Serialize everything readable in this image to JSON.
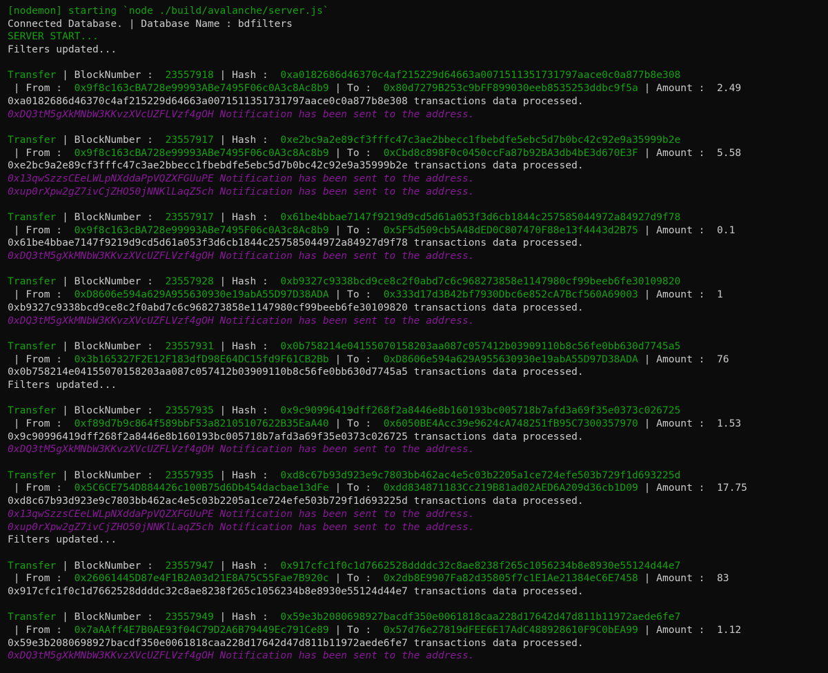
{
  "terminal": {
    "colors": {
      "background": "#0c0c0c",
      "default": "#cccccc",
      "green": "#13a10e",
      "purple": "#881798"
    },
    "lines": [
      {
        "kind": "text",
        "parts": [
          {
            "t": "[nodemon] starting `node ./build/avalanche/server.js`",
            "c": "g"
          }
        ]
      },
      {
        "kind": "text",
        "parts": [
          {
            "t": "Connected Database. | Database Name : bdfilters",
            "c": "w"
          }
        ]
      },
      {
        "kind": "text",
        "parts": [
          {
            "t": "SERVER START...",
            "c": "g"
          }
        ]
      },
      {
        "kind": "text",
        "parts": [
          {
            "t": "Filters updated...",
            "c": "w"
          }
        ]
      },
      {
        "kind": "blank",
        "parts": []
      },
      {
        "kind": "transfer",
        "parts": [
          {
            "t": "Transfer",
            "c": "g"
          },
          {
            "t": " | BlockNumber :  ",
            "c": "w"
          },
          {
            "t": "23557918",
            "c": "g"
          },
          {
            "t": " | Hash :  ",
            "c": "w"
          },
          {
            "t": "0xa0182686d46370c4af215229d64663a0071511351731797aace0c0a877b8e308",
            "c": "g"
          }
        ]
      },
      {
        "kind": "transfer-detail",
        "parts": [
          {
            "t": " | From :  ",
            "c": "w"
          },
          {
            "t": "0x9f8c163cBA728e99993ABe7495F06c0A3c8Ac8b9",
            "c": "g"
          },
          {
            "t": " | To :  ",
            "c": "w"
          },
          {
            "t": "0x80d7279B253c9bFF899030eeb8535253ddbc9f5a",
            "c": "g"
          },
          {
            "t": " | Amount :  2.49",
            "c": "w"
          }
        ]
      },
      {
        "kind": "processed",
        "parts": [
          {
            "t": "0xa0182686d46370c4af215229d64663a0071511351731797aace0c0a877b8e308 transactions data processed.",
            "c": "w"
          }
        ]
      },
      {
        "kind": "notification",
        "parts": [
          {
            "t": "0xDQ3tM5gXkMNbW3KKvzXVcUZFLVzf4gOH Notification has been sent to the address.",
            "c": "p"
          }
        ]
      },
      {
        "kind": "blank",
        "parts": []
      },
      {
        "kind": "transfer",
        "parts": [
          {
            "t": "Transfer",
            "c": "g"
          },
          {
            "t": " | BlockNumber :  ",
            "c": "w"
          },
          {
            "t": "23557917",
            "c": "g"
          },
          {
            "t": " | Hash :  ",
            "c": "w"
          },
          {
            "t": "0xe2bc9a2e89cf3fffc47c3ae2bbecc1fbebdfe5ebc5d7b0bc42c92e9a35999b2e",
            "c": "g"
          }
        ]
      },
      {
        "kind": "transfer-detail",
        "parts": [
          {
            "t": " | From :  ",
            "c": "w"
          },
          {
            "t": "0x9f8c163cBA728e99993ABe7495F06c0A3c8Ac8b9",
            "c": "g"
          },
          {
            "t": " | To :  ",
            "c": "w"
          },
          {
            "t": "0xCbd8c898F0c0450ccFa87b92BA3db4bE3d670E3F",
            "c": "g"
          },
          {
            "t": " | Amount :  5.58",
            "c": "w"
          }
        ]
      },
      {
        "kind": "processed",
        "parts": [
          {
            "t": "0xe2bc9a2e89cf3fffc47c3ae2bbecc1fbebdfe5ebc5d7b0bc42c92e9a35999b2e transactions data processed.",
            "c": "w"
          }
        ]
      },
      {
        "kind": "notification",
        "parts": [
          {
            "t": "0x13qwSzzsCEeLWLpNXddaPpVQZXFGUuPE Notification has been sent to the address.",
            "c": "p"
          }
        ]
      },
      {
        "kind": "notification",
        "parts": [
          {
            "t": "0xup0rXpw2gZ7ivCjZHO50jNNKlLaqZ5ch Notification has been sent to the address.",
            "c": "p"
          }
        ]
      },
      {
        "kind": "blank",
        "parts": []
      },
      {
        "kind": "transfer",
        "parts": [
          {
            "t": "Transfer",
            "c": "g"
          },
          {
            "t": " | BlockNumber :  ",
            "c": "w"
          },
          {
            "t": "23557917",
            "c": "g"
          },
          {
            "t": " | Hash :  ",
            "c": "w"
          },
          {
            "t": "0x61be4bbae7147f9219d9cd5d61a053f3d6cb1844c257585044972a84927d9f78",
            "c": "g"
          }
        ]
      },
      {
        "kind": "transfer-detail",
        "parts": [
          {
            "t": " | From :  ",
            "c": "w"
          },
          {
            "t": "0x9f8c163cBA728e99993ABe7495F06c0A3c8Ac8b9",
            "c": "g"
          },
          {
            "t": " | To :  ",
            "c": "w"
          },
          {
            "t": "0x5F5d509cb5A48dED0C807470F88e13f4443d2B75",
            "c": "g"
          },
          {
            "t": " | Amount :  0.1",
            "c": "w"
          }
        ]
      },
      {
        "kind": "processed",
        "parts": [
          {
            "t": "0x61be4bbae7147f9219d9cd5d61a053f3d6cb1844c257585044972a84927d9f78 transactions data processed.",
            "c": "w"
          }
        ]
      },
      {
        "kind": "notification",
        "parts": [
          {
            "t": "0xDQ3tM5gXkMNbW3KKvzXVcUZFLVzf4gOH Notification has been sent to the address.",
            "c": "p"
          }
        ]
      },
      {
        "kind": "blank",
        "parts": []
      },
      {
        "kind": "transfer",
        "parts": [
          {
            "t": "Transfer",
            "c": "g"
          },
          {
            "t": " | BlockNumber :  ",
            "c": "w"
          },
          {
            "t": "23557928",
            "c": "g"
          },
          {
            "t": " | Hash :  ",
            "c": "w"
          },
          {
            "t": "0xb9327c9338bcd9ce8c2f0abd7c6c968273858e1147980cf99beeb6fe30109820",
            "c": "g"
          }
        ]
      },
      {
        "kind": "transfer-detail",
        "parts": [
          {
            "t": " | From :  ",
            "c": "w"
          },
          {
            "t": "0xD8606e594a629A955630930e19abA55D97D38ADA",
            "c": "g"
          },
          {
            "t": " | To :  ",
            "c": "w"
          },
          {
            "t": "0x333d17d3B42bf7930Dbc6e852cA7Bcf560A69003",
            "c": "g"
          },
          {
            "t": " | Amount :  1",
            "c": "w"
          }
        ]
      },
      {
        "kind": "processed",
        "parts": [
          {
            "t": "0xb9327c9338bcd9ce8c2f0abd7c6c968273858e1147980cf99beeb6fe30109820 transactions data processed.",
            "c": "w"
          }
        ]
      },
      {
        "kind": "notification",
        "parts": [
          {
            "t": "0xDQ3tM5gXkMNbW3KKvzXVcUZFLVzf4gOH Notification has been sent to the address.",
            "c": "p"
          }
        ]
      },
      {
        "kind": "blank",
        "parts": []
      },
      {
        "kind": "transfer",
        "parts": [
          {
            "t": "Transfer",
            "c": "g"
          },
          {
            "t": " | BlockNumber :  ",
            "c": "w"
          },
          {
            "t": "23557931",
            "c": "g"
          },
          {
            "t": " | Hash :  ",
            "c": "w"
          },
          {
            "t": "0x0b758214e04155070158203aa087c057412b03909110b8c56fe0bb630d7745a5",
            "c": "g"
          }
        ]
      },
      {
        "kind": "transfer-detail",
        "parts": [
          {
            "t": " | From :  ",
            "c": "w"
          },
          {
            "t": "0x3b165327F2E12F183dfD98E64DC15fd9F61CB2Bb",
            "c": "g"
          },
          {
            "t": " | To :  ",
            "c": "w"
          },
          {
            "t": "0xD8606e594a629A955630930e19abA55D97D38ADA",
            "c": "g"
          },
          {
            "t": " | Amount :  76",
            "c": "w"
          }
        ]
      },
      {
        "kind": "processed",
        "parts": [
          {
            "t": "0x0b758214e04155070158203aa087c057412b03909110b8c56fe0bb630d7745a5 transactions data processed.",
            "c": "w"
          }
        ]
      },
      {
        "kind": "text",
        "parts": [
          {
            "t": "Filters updated...",
            "c": "w"
          }
        ]
      },
      {
        "kind": "blank",
        "parts": []
      },
      {
        "kind": "transfer",
        "parts": [
          {
            "t": "Transfer",
            "c": "g"
          },
          {
            "t": " | BlockNumber :  ",
            "c": "w"
          },
          {
            "t": "23557935",
            "c": "g"
          },
          {
            "t": " | Hash :  ",
            "c": "w"
          },
          {
            "t": "0x9c90996419dff268f2a8446e8b160193bc005718b7afd3a69f35e0373c026725",
            "c": "g"
          }
        ]
      },
      {
        "kind": "transfer-detail",
        "parts": [
          {
            "t": " | From :  ",
            "c": "w"
          },
          {
            "t": "0xf89d7b9c864f589bbF53a82105107622B35EaA40",
            "c": "g"
          },
          {
            "t": " | To :  ",
            "c": "w"
          },
          {
            "t": "0x6050BE4Acc39e9624cA748251fB95C7300357970",
            "c": "g"
          },
          {
            "t": " | Amount :  1.53",
            "c": "w"
          }
        ]
      },
      {
        "kind": "processed",
        "parts": [
          {
            "t": "0x9c90996419dff268f2a8446e8b160193bc005718b7afd3a69f35e0373c026725 transactions data processed.",
            "c": "w"
          }
        ]
      },
      {
        "kind": "notification",
        "parts": [
          {
            "t": "0xDQ3tM5gXkMNbW3KKvzXVcUZFLVzf4gOH Notification has been sent to the address.",
            "c": "p"
          }
        ]
      },
      {
        "kind": "blank",
        "parts": []
      },
      {
        "kind": "transfer",
        "parts": [
          {
            "t": "Transfer",
            "c": "g"
          },
          {
            "t": " | BlockNumber :  ",
            "c": "w"
          },
          {
            "t": "23557935",
            "c": "g"
          },
          {
            "t": " | Hash :  ",
            "c": "w"
          },
          {
            "t": "0xd8c67b93d923e9c7803bb462ac4e5c03b2205a1ce724efe503b729f1d693225d",
            "c": "g"
          }
        ]
      },
      {
        "kind": "transfer-detail",
        "parts": [
          {
            "t": " | From :  ",
            "c": "w"
          },
          {
            "t": "0x5C6CE754D884426c100B75d6Db454dacbae13dFe",
            "c": "g"
          },
          {
            "t": " | To :  ",
            "c": "w"
          },
          {
            "t": "0xdd834871183Cc219B81ad02AED6A209d36cb1D09",
            "c": "g"
          },
          {
            "t": " | Amount :  17.75",
            "c": "w"
          }
        ]
      },
      {
        "kind": "processed",
        "parts": [
          {
            "t": "0xd8c67b93d923e9c7803bb462ac4e5c03b2205a1ce724efe503b729f1d693225d transactions data processed.",
            "c": "w"
          }
        ]
      },
      {
        "kind": "notification",
        "parts": [
          {
            "t": "0x13qwSzzsCEeLWLpNXddaPpVQZXFGUuPE Notification has been sent to the address.",
            "c": "p"
          }
        ]
      },
      {
        "kind": "notification",
        "parts": [
          {
            "t": "0xup0rXpw2gZ7ivCjZHO50jNNKlLaqZ5ch Notification has been sent to the address.",
            "c": "p"
          }
        ]
      },
      {
        "kind": "text",
        "parts": [
          {
            "t": "Filters updated...",
            "c": "w"
          }
        ]
      },
      {
        "kind": "blank",
        "parts": []
      },
      {
        "kind": "transfer",
        "parts": [
          {
            "t": "Transfer",
            "c": "g"
          },
          {
            "t": " | BlockNumber :  ",
            "c": "w"
          },
          {
            "t": "23557947",
            "c": "g"
          },
          {
            "t": " | Hash :  ",
            "c": "w"
          },
          {
            "t": "0x917cfc1f0c1d7662528ddddc32c8ae8238f265c1056234b8e8930e55124d44e7",
            "c": "g"
          }
        ]
      },
      {
        "kind": "transfer-detail",
        "parts": [
          {
            "t": " | From :  ",
            "c": "w"
          },
          {
            "t": "0x26061445D87e4F1B2A03d21E8A75C55Fae7B920c",
            "c": "g"
          },
          {
            "t": " | To :  ",
            "c": "w"
          },
          {
            "t": "0x2db8E9907Fa82d35805f7c1E1Ae21384eC6E7458",
            "c": "g"
          },
          {
            "t": " | Amount :  83",
            "c": "w"
          }
        ]
      },
      {
        "kind": "processed",
        "parts": [
          {
            "t": "0x917cfc1f0c1d7662528ddddc32c8ae8238f265c1056234b8e8930e55124d44e7 transactions data processed.",
            "c": "w"
          }
        ]
      },
      {
        "kind": "blank",
        "parts": []
      },
      {
        "kind": "transfer",
        "parts": [
          {
            "t": "Transfer",
            "c": "g"
          },
          {
            "t": " | BlockNumber :  ",
            "c": "w"
          },
          {
            "t": "23557949",
            "c": "g"
          },
          {
            "t": " | Hash :  ",
            "c": "w"
          },
          {
            "t": "0x59e3b2080698927bacdf350e0061818caa228d17642d47d811b11972aede6fe7",
            "c": "g"
          }
        ]
      },
      {
        "kind": "transfer-detail",
        "parts": [
          {
            "t": " | From :  ",
            "c": "w"
          },
          {
            "t": "0x7aAAff4E7B0AE93f04C79D2A6B79449Ec791Ce89",
            "c": "g"
          },
          {
            "t": " | To :  ",
            "c": "w"
          },
          {
            "t": "0x57d76e27819dFEE6E17AdC488928610F9C0bEA99",
            "c": "g"
          },
          {
            "t": " | Amount :  1.12",
            "c": "w"
          }
        ]
      },
      {
        "kind": "processed",
        "parts": [
          {
            "t": "0x59e3b2080698927bacdf350e0061818caa228d17642d47d811b11972aede6fe7 transactions data processed.",
            "c": "w"
          }
        ]
      },
      {
        "kind": "notification",
        "parts": [
          {
            "t": "0xDQ3tM5gXkMNbW3KKvzXVcUZFLVzf4gOH Notification has been sent to the address.",
            "c": "p"
          }
        ]
      }
    ]
  }
}
